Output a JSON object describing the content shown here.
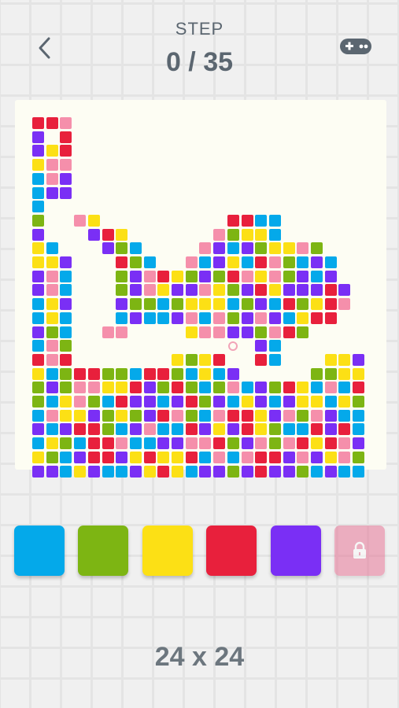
{
  "header": {
    "step_label": "STEP",
    "step_value": "0 / 35"
  },
  "icons": {
    "back": "chevron-left-icon",
    "games": "gamepad-icon",
    "lock": "lock-icon"
  },
  "colors": {
    "B": "#04a9ea",
    "G": "#7db513",
    "Y": "#fce015",
    "R": "#e8203c",
    "P": "#7a2ff5",
    "K": "#f58fab"
  },
  "palette": [
    {
      "name": "blue",
      "color": "#04a9ea",
      "locked": false
    },
    {
      "name": "green",
      "color": "#7db513",
      "locked": false
    },
    {
      "name": "yellow",
      "color": "#fce015",
      "locked": false
    },
    {
      "name": "red",
      "color": "#e8203c",
      "locked": false
    },
    {
      "name": "purple",
      "color": "#7a2ff5",
      "locked": false
    },
    {
      "name": "pink",
      "color": "#e75e86",
      "locked": true
    }
  ],
  "board": {
    "size_label": "24 x 24",
    "grid": [
      "RRK.....................",
      "P.R.....................",
      "PYR.....................",
      "YKK.....................",
      "BKP.....................",
      "BPP.....................",
      "B.......................",
      "G..KY.........RRBB......",
      "P...PRY......KGYYB......",
      "YB...PGB....KPBPGYYKG...",
      "YYP...RGB..KBPYBRKGBPB..",
      "PKB...GPKRYGPGRKYKGPBP..",
      "PKB...GPKYPPKYGPRYPPPRP.",
      "BYP...PGGBGYYYBGPBRGYRK.",
      "BYB...BPBBPKBKGPKPBYRR..",
      "PGB..KK....YKKPPGKRG....",
      "BKG.............PB......",
      "RKR.......YGYR..RB...YYP",
      "YBGRRGGBRRGBYBP.....GGYY",
      "GPGKKYYRPGRGBGKBPGRYBKBR",
      "GBYKGBRPPBPRGPBYPBPYYBYG",
      "BKYYPGYGPRKGBKRRYPKGKPBB",
      "PBPRRGBPKBBRPYPRYGBBRPRB",
      "BYGBRRKBBPPKKRGPKGKRYRKP",
      "YGBPRRPYRYYRBKBKRRPKPYKG",
      "PPBYPBBPYRYBPPGPRPPGBPBB"
    ],
    "target_cell": {
      "row": 16,
      "col": 14
    }
  }
}
